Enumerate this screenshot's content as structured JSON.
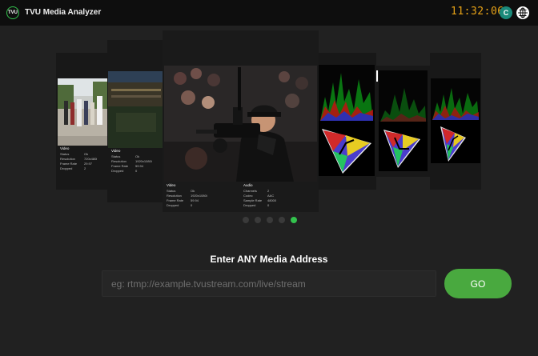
{
  "app": {
    "logo_text": "TVU",
    "title": "TVU Media Analyzer",
    "clock": "11:32:06",
    "avatar_initial": "C"
  },
  "carousel": {
    "panels": {
      "p1": {
        "header": "Video",
        "rows": [
          [
            "Status",
            "Ok"
          ],
          [
            "Resolution",
            "720x480i"
          ],
          [
            "Frame Rate",
            "29.97"
          ],
          [
            "Dropped",
            "2"
          ]
        ]
      },
      "p2": {
        "header": "Video",
        "rows": [
          [
            "Status",
            "Ok"
          ],
          [
            "Resolution",
            "1920x1080i"
          ],
          [
            "Frame Rate",
            "59.94"
          ],
          [
            "Dropped",
            "0"
          ]
        ]
      },
      "p3": {
        "header": "Video",
        "rows": [
          [
            "Status",
            "Ok"
          ],
          [
            "Resolution",
            "1920x1080i"
          ],
          [
            "Frame Rate",
            "59.94"
          ],
          [
            "Dropped",
            "0"
          ]
        ]
      },
      "p4": {
        "header": "Audio",
        "rows": [
          [
            "Channels",
            "2"
          ],
          [
            "Codec",
            "AAC"
          ],
          [
            "Sample Rate",
            "48000"
          ],
          [
            "Dropped",
            "0"
          ]
        ]
      }
    },
    "dots": 5,
    "active_dot": 5
  },
  "connect": {
    "prompt": "Enter ANY Media Address",
    "placeholder": "eg: rtmp://example.tvustream.com/live/stream",
    "go_label": "GO"
  },
  "colors": {
    "accent": "#33c24d",
    "go_button": "#49a93f",
    "clock": "#e8a317",
    "avatar": "#1a8a7a"
  },
  "icons": {
    "logo": "tvu-logo-icon",
    "globe": "globe-icon"
  }
}
